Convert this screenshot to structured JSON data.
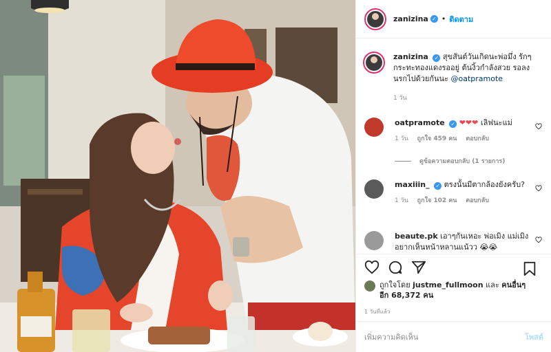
{
  "header": {
    "username": "zanizina",
    "follow_label": "ติดตาม",
    "dot": "•"
  },
  "caption": {
    "username": "zanizina",
    "text": "สุขสันต์วันเกิดนะพ่อมึ่ง รักๆกระทะทองแดงรออยู่ ต้นงิ้วกำลังสวย รอลงนรกไปด้วยกันนะ",
    "mention": "@oatpramote",
    "time": "1 วัน"
  },
  "comments": [
    {
      "username": "oatpramote",
      "verified": true,
      "hearts": "❤❤❤",
      "text": "เลิฟนะแม่",
      "time": "1 วัน",
      "likes": "ถูกใจ 459 คน",
      "reply": "ตอบกลับ",
      "avatar_color": "#c0392b"
    },
    {
      "username": "maxiiin_",
      "verified": true,
      "hearts": "",
      "text": "ตรงนั้นมีตากล้องยังครับ?",
      "time": "1 วัน",
      "likes": "ถูกใจ 102 คน",
      "reply": "ตอบกลับ",
      "avatar_color": "#5a5a5a"
    },
    {
      "username": "beaute.pk",
      "verified": false,
      "hearts": "",
      "text": "เอาๆกันเหอะ พ่อเมิง แม่เมิง อยากเห็นหน้าหลานแน้วว 😭😭",
      "time": "",
      "likes": "",
      "reply": "",
      "avatar_color": "#9a9a9a"
    }
  ],
  "replies_link": "ดูข้อความตอบกลับ (1 รายการ)",
  "likes": {
    "prefix": "ถูกใจโดย",
    "user": "justme_fullmoon",
    "and": "และ",
    "others": "คนอื่นๆ อีก 68,372 คน"
  },
  "timestamp": "1 วันที่แล้ว",
  "add_comment": {
    "placeholder": "เพิ่มความคิดเห็น",
    "post_label": "โพสต์"
  },
  "icons": {
    "verified": "verified-badge-icon",
    "like": "heart-icon",
    "comment": "comment-bubble-icon",
    "share": "paper-plane-icon",
    "save": "bookmark-icon"
  },
  "colors": {
    "link_blue": "#0095f6",
    "verified_blue": "#3897f0",
    "secondary_text": "#8e8e8e",
    "divider": "#efefef",
    "post_disabled": "#b2dffc",
    "heart_red": "#ed4956"
  }
}
